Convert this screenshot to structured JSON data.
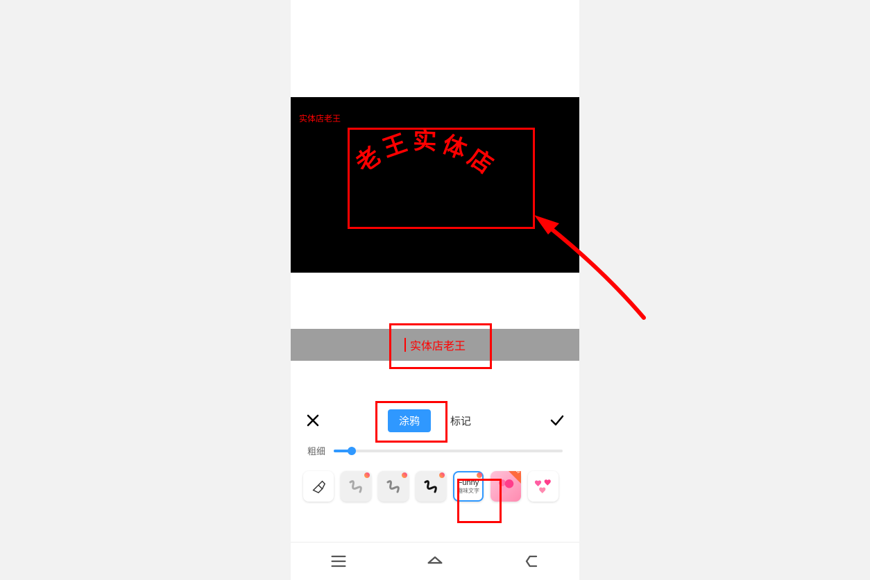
{
  "canvas": {
    "watermark_label": "实体店老王",
    "arc_chars": [
      "老",
      "王",
      "实",
      "体",
      "店"
    ]
  },
  "text_input": {
    "value": "实体店老王"
  },
  "panel": {
    "tabs": {
      "doodle": "涂鸦",
      "mark": "标记"
    },
    "slider_label": "粗细",
    "brushes": {
      "funny_title": "Funny",
      "funny_sub": "趣味文字",
      "sticker_new_label": "NEW"
    }
  },
  "colors": {
    "accent": "#ff0000",
    "primary": "#2f98ff"
  }
}
